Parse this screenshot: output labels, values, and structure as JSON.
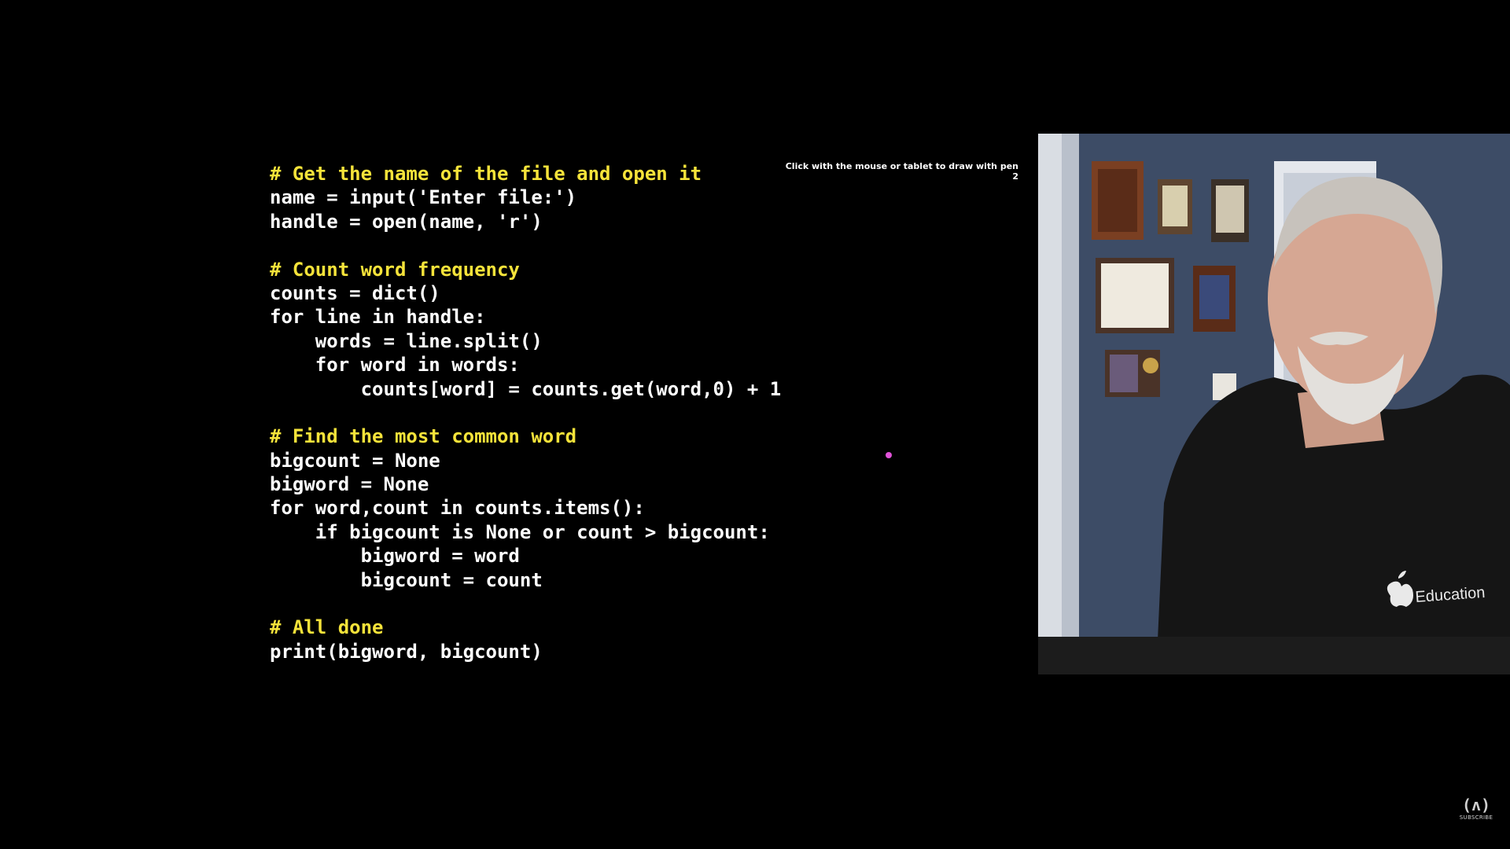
{
  "code_lines": [
    {
      "text": "# Get the name of the file and open it",
      "kind": "comment"
    },
    {
      "text": "name = input('Enter file:')",
      "kind": "code"
    },
    {
      "text": "handle = open(name, 'r')",
      "kind": "code"
    },
    {
      "text": "",
      "kind": "blank"
    },
    {
      "text": "# Count word frequency",
      "kind": "comment"
    },
    {
      "text": "counts = dict()",
      "kind": "code"
    },
    {
      "text": "for line in handle:",
      "kind": "code"
    },
    {
      "text": "    words = line.split()",
      "kind": "code"
    },
    {
      "text": "    for word in words:",
      "kind": "code"
    },
    {
      "text": "        counts[word] = counts.get(word,0) + 1",
      "kind": "code"
    },
    {
      "text": "",
      "kind": "blank"
    },
    {
      "text": "# Find the most common word",
      "kind": "comment"
    },
    {
      "text": "bigcount = None",
      "kind": "code"
    },
    {
      "text": "bigword = None",
      "kind": "code"
    },
    {
      "text": "for word,count in counts.items():",
      "kind": "code"
    },
    {
      "text": "    if bigcount is None or count > bigcount:",
      "kind": "code"
    },
    {
      "text": "        bigword = word",
      "kind": "code"
    },
    {
      "text": "        bigcount = count",
      "kind": "code"
    },
    {
      "text": "",
      "kind": "blank"
    },
    {
      "text": "# All done",
      "kind": "comment"
    },
    {
      "text": "print(bigword, bigcount)",
      "kind": "code"
    }
  ],
  "pen_hint": "Click with the mouse or tablet to draw with pen 2",
  "pen_color": "#e052d8",
  "comment_color": "#f5e33a",
  "webcam": {
    "shirt_text": "Education",
    "icon": "apple-logo-icon"
  },
  "subscribe": {
    "logo_text": "(ʌ)",
    "label": "SUBSCRIBE",
    "icon": "freecodecamp-logo-icon"
  }
}
